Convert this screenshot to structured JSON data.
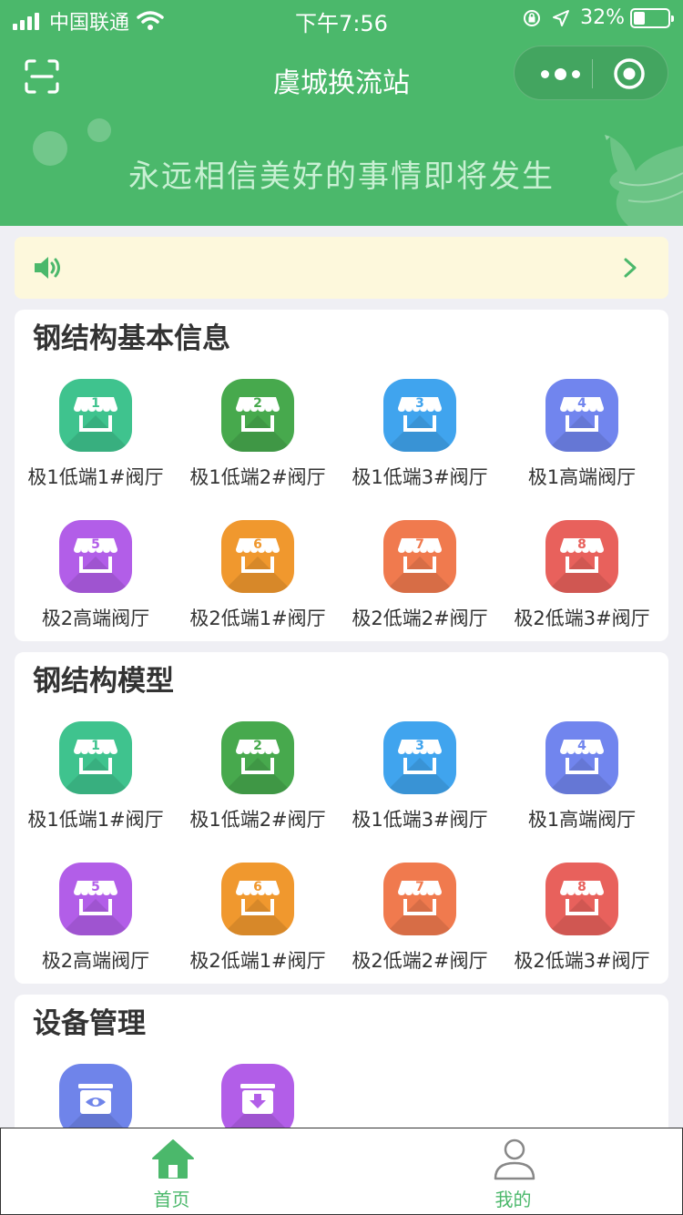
{
  "status_bar": {
    "carrier": "中国联通",
    "time": "下午7:56",
    "battery": "32%",
    "battery_level": 0.32
  },
  "nav": {
    "title": "虞城换流站"
  },
  "banner": {
    "slogan": "永远相信美好的事情即将发生"
  },
  "notice": {
    "text": ""
  },
  "sections": [
    {
      "title": "钢结构基本信息",
      "items": [
        {
          "number": "1",
          "label": "极1低端1#阀厅",
          "color": "#3fc38e"
        },
        {
          "number": "2",
          "label": "极1低端2#阀厅",
          "color": "#47a94d"
        },
        {
          "number": "3",
          "label": "极1低端3#阀厅",
          "color": "#40a4ee"
        },
        {
          "number": "4",
          "label": "极1高端阀厅",
          "color": "#7185ee"
        },
        {
          "number": "5",
          "label": "极2高端阀厅",
          "color": "#b25ee8"
        },
        {
          "number": "6",
          "label": "极2低端1#阀厅",
          "color": "#f0982e"
        },
        {
          "number": "7",
          "label": "极2低端2#阀厅",
          "color": "#f07a4e"
        },
        {
          "number": "8",
          "label": "极2低端3#阀厅",
          "color": "#e8615c"
        }
      ]
    },
    {
      "title": "钢结构模型",
      "items": [
        {
          "number": "1",
          "label": "极1低端1#阀厅",
          "color": "#3fc38e"
        },
        {
          "number": "2",
          "label": "极1低端2#阀厅",
          "color": "#47a94d"
        },
        {
          "number": "3",
          "label": "极1低端3#阀厅",
          "color": "#40a4ee"
        },
        {
          "number": "4",
          "label": "极1高端阀厅",
          "color": "#7185ee"
        },
        {
          "number": "5",
          "label": "极2高端阀厅",
          "color": "#b25ee8"
        },
        {
          "number": "6",
          "label": "极2低端1#阀厅",
          "color": "#f0982e"
        },
        {
          "number": "7",
          "label": "极2低端2#阀厅",
          "color": "#f07a4e"
        },
        {
          "number": "8",
          "label": "极2低端3#阀厅",
          "color": "#e8615c"
        }
      ]
    },
    {
      "title": "设备管理",
      "items": [
        {
          "icon": "eye-box-icon",
          "color": "#6f84ea"
        },
        {
          "icon": "download-box-icon",
          "color": "#b25ee8"
        }
      ]
    }
  ],
  "tabs": [
    {
      "label": "首页",
      "icon": "home-icon",
      "active": true,
      "color": "#4bb86b"
    },
    {
      "label": "我的",
      "icon": "user-icon",
      "active": false,
      "color": "#888888"
    }
  ],
  "colors": {
    "primary": "#4bb86b",
    "notice_bg": "#fdf8dc",
    "page_bg": "#efeff4"
  }
}
